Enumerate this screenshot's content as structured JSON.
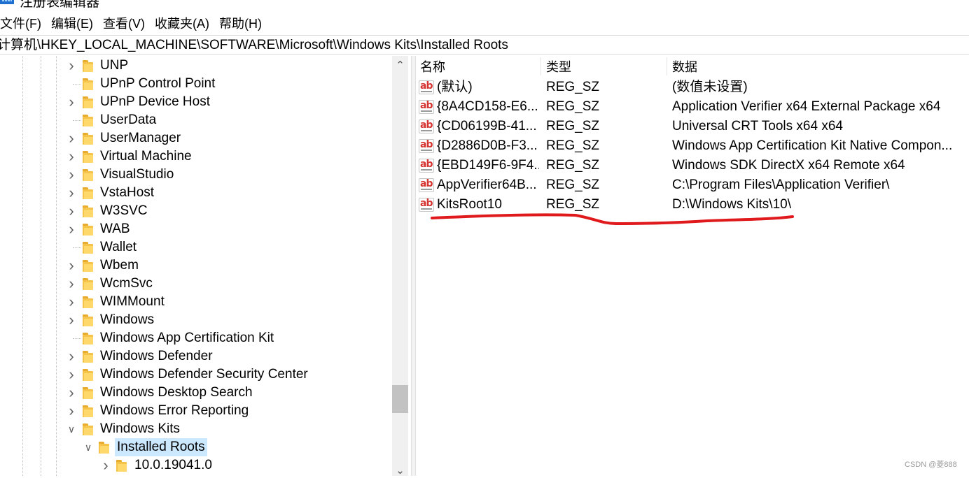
{
  "window": {
    "title": "注册表编辑器"
  },
  "menu": [
    "文件(F)",
    "编辑(E)",
    "查看(V)",
    "收藏夹(A)",
    "帮助(H)"
  ],
  "address": "计算机\\HKEY_LOCAL_MACHINE\\SOFTWARE\\Microsoft\\Windows Kits\\Installed Roots",
  "tree": [
    {
      "label": "UNP",
      "expander": "collapsed",
      "level": 0
    },
    {
      "label": "UPnP Control Point",
      "expander": "none",
      "level": 0
    },
    {
      "label": "UPnP Device Host",
      "expander": "collapsed",
      "level": 0
    },
    {
      "label": "UserData",
      "expander": "none",
      "level": 0
    },
    {
      "label": "UserManager",
      "expander": "collapsed",
      "level": 0
    },
    {
      "label": "Virtual Machine",
      "expander": "collapsed",
      "level": 0
    },
    {
      "label": "VisualStudio",
      "expander": "collapsed",
      "level": 0
    },
    {
      "label": "VstaHost",
      "expander": "collapsed",
      "level": 0
    },
    {
      "label": "W3SVC",
      "expander": "collapsed",
      "level": 0
    },
    {
      "label": "WAB",
      "expander": "collapsed",
      "level": 0
    },
    {
      "label": "Wallet",
      "expander": "none",
      "level": 0
    },
    {
      "label": "Wbem",
      "expander": "collapsed",
      "level": 0
    },
    {
      "label": "WcmSvc",
      "expander": "collapsed",
      "level": 0
    },
    {
      "label": "WIMMount",
      "expander": "collapsed",
      "level": 0
    },
    {
      "label": "Windows",
      "expander": "collapsed",
      "level": 0
    },
    {
      "label": "Windows App Certification Kit",
      "expander": "none",
      "level": 0
    },
    {
      "label": "Windows Defender",
      "expander": "collapsed",
      "level": 0
    },
    {
      "label": "Windows Defender Security Center",
      "expander": "collapsed",
      "level": 0
    },
    {
      "label": "Windows Desktop Search",
      "expander": "collapsed",
      "level": 0
    },
    {
      "label": "Windows Error Reporting",
      "expander": "collapsed",
      "level": 0
    },
    {
      "label": "Windows Kits",
      "expander": "expanded",
      "level": 0
    },
    {
      "label": "Installed Roots",
      "expander": "expanded",
      "level": 1,
      "selected": true
    },
    {
      "label": "10.0.19041.0",
      "expander": "collapsed",
      "level": 2
    }
  ],
  "list": {
    "columns": [
      "名称",
      "类型",
      "数据"
    ],
    "rows": [
      {
        "name": "(默认)",
        "type": "REG_SZ",
        "data": "(数值未设置)"
      },
      {
        "name": "{8A4CD158-E6...",
        "type": "REG_SZ",
        "data": "Application Verifier x64 External Package x64"
      },
      {
        "name": "{CD06199B-41...",
        "type": "REG_SZ",
        "data": "Universal CRT Tools x64 x64"
      },
      {
        "name": "{D2886D0B-F3...",
        "type": "REG_SZ",
        "data": "Windows App Certification Kit Native Compon..."
      },
      {
        "name": "{EBD149F6-9F4...",
        "type": "REG_SZ",
        "data": "Windows SDK DirectX x64 Remote x64"
      },
      {
        "name": "AppVerifier64B...",
        "type": "REG_SZ",
        "data": "C:\\Program Files\\Application Verifier\\"
      },
      {
        "name": "KitsRoot10",
        "type": "REG_SZ",
        "data": "D:\\Windows Kits\\10\\"
      }
    ]
  },
  "value_icon": "string-value-icon",
  "annotation_color": "#e0191c",
  "watermark": "CSDN @菱888"
}
